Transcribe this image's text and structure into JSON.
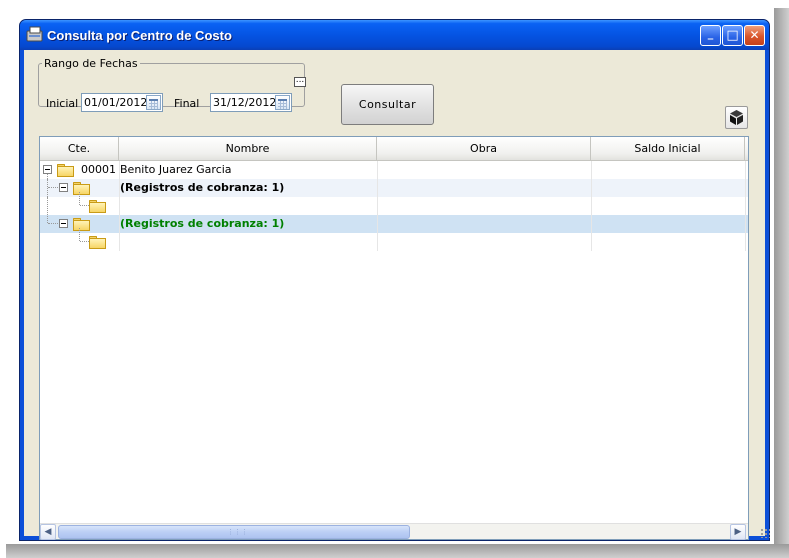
{
  "window": {
    "title": "Consulta por Centro de Costo",
    "controls": {
      "minimize": "_",
      "maximize": "□",
      "close": "✕"
    }
  },
  "filter": {
    "legend": "Rango de Fechas",
    "start_label": "Inicial",
    "start_value": "01/01/2012",
    "end_label": "Final",
    "end_value": "31/12/2012",
    "ellipsis": "..."
  },
  "toolbar": {
    "consultar_label": "Consultar",
    "box_icon": "cube-icon"
  },
  "grid": {
    "columns": [
      "Cte.",
      "Nombre",
      "Obra",
      "Saldo Inicial"
    ],
    "rows": [
      {
        "level": 0,
        "cte": "00001",
        "nombre": "Benito Juarez Garcia",
        "obra": "",
        "saldo": ""
      },
      {
        "level": 1,
        "cte": "",
        "nombre": "(Registros de cobranza: 1)",
        "obra": "",
        "saldo": ""
      },
      {
        "level": 2,
        "cte": "",
        "nombre": "",
        "obra": "",
        "saldo": ""
      },
      {
        "level": 1,
        "cte": "",
        "nombre": "(Registros de cobranza: 1)",
        "obra": "",
        "saldo": ""
      },
      {
        "level": 2,
        "cte": "",
        "nombre": "",
        "obra": "",
        "saldo": ""
      }
    ],
    "selected_row": 3
  },
  "scrollbar": {
    "left": "◀",
    "right": "▶",
    "grip": "⋮⋮⋮"
  },
  "colors": {
    "title_bar": "#0554e3",
    "client_bg": "#ece9d8",
    "selected_row": "#cfe2f3",
    "alt_row": "#eef3fa",
    "selected_text": "#008000"
  }
}
